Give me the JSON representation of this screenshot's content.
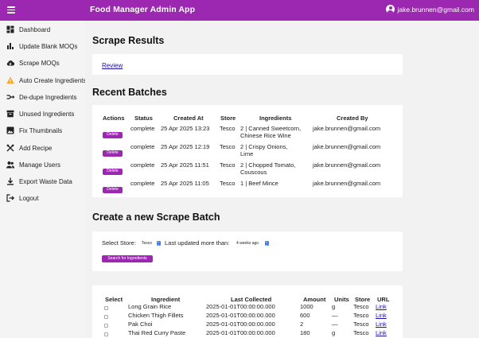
{
  "app": {
    "title": "Food Manager Admin App",
    "user_email": "jake.brunnen@gmail.com"
  },
  "sidebar": {
    "items": [
      {
        "label": "Dashboard",
        "icon": "dashboard-icon"
      },
      {
        "label": "Update Blank MOQs",
        "icon": "bar-chart-icon"
      },
      {
        "label": "Scrape MOQs",
        "icon": "cloud-download-icon"
      },
      {
        "label": "Auto Create Ingredients",
        "icon": "warning-icon",
        "icon_color": "#f5a623"
      },
      {
        "label": "De-dupe Ingredients",
        "icon": "merge-icon"
      },
      {
        "label": "Unused Ingredients",
        "icon": "inventory-icon"
      },
      {
        "label": "Fix Thumbnails",
        "icon": "image-icon"
      },
      {
        "label": "Add Recipe",
        "icon": "utensils-icon"
      },
      {
        "label": "Manage Users",
        "icon": "users-icon"
      },
      {
        "label": "Export Waste Data",
        "icon": "download-icon"
      },
      {
        "label": "Logout",
        "icon": "logout-icon"
      }
    ]
  },
  "scrape_results": {
    "title": "Scrape Results",
    "review_link": "Review"
  },
  "recent_batches": {
    "title": "Recent Batches",
    "headers": [
      "Actions",
      "Status",
      "Created At",
      "Store",
      "Ingredients",
      "Created By"
    ],
    "action_label": "Delete",
    "rows": [
      {
        "status": "complete",
        "created_at": "25 Apr 2025 13:23",
        "store": "Tesco",
        "ingredients": [
          "2 | Canned Sweetcorn,",
          "Chinese Rice Wine"
        ],
        "created_by": "jake.brunnen@gmail.com"
      },
      {
        "status": "complete",
        "created_at": "25 Apr 2025 12:19",
        "store": "Tesco",
        "ingredients": [
          "2 | Crispy Onions,",
          "Lime"
        ],
        "created_by": "jake.brunnen@gmail.com"
      },
      {
        "status": "complete",
        "created_at": "25 Apr 2025 11:51",
        "store": "Tesco",
        "ingredients": [
          "2 | Chopped Tomato,",
          "Couscous"
        ],
        "created_by": "jake.brunnen@gmail.com"
      },
      {
        "status": "complete",
        "created_at": "25 Apr 2025 11:05",
        "store": "Tesco",
        "ingredients": [
          "1 | Beef Mince"
        ],
        "created_by": "jake.brunnen@gmail.com"
      }
    ]
  },
  "new_batch": {
    "title": "Create a new Scrape Batch",
    "select_store_label": "Select Store:",
    "store_value": "Tesco",
    "last_updated_label": "Last updated more than:",
    "last_updated_value": "4 weeks ago",
    "search_button": "Search for Ingredients"
  },
  "ingredients_table": {
    "headers": [
      "Select",
      "Ingredient",
      "Last Collected",
      "Amount",
      "Units",
      "Store",
      "URL"
    ],
    "rows": [
      {
        "ingredient": "Long Grain Rice",
        "last_collected": "2025-01-01T00:00:00.000",
        "amount": "1000",
        "units": "g",
        "store": "Tesco",
        "url": "Link"
      },
      {
        "ingredient": "Chicken Thigh Fillets",
        "last_collected": "2025-01-01T00:00:00.000",
        "amount": "600",
        "units": "—",
        "store": "Tesco",
        "url": "Link"
      },
      {
        "ingredient": "Pak Choi",
        "last_collected": "2025-01-01T00:00:00.000",
        "amount": "2",
        "units": "—",
        "store": "Tesco",
        "url": "Link"
      },
      {
        "ingredient": "Thai Red Curry Paste",
        "last_collected": "2025-01-01T00:00:00.000",
        "amount": "180",
        "units": "g",
        "store": "Tesco",
        "url": "Link"
      }
    ]
  }
}
